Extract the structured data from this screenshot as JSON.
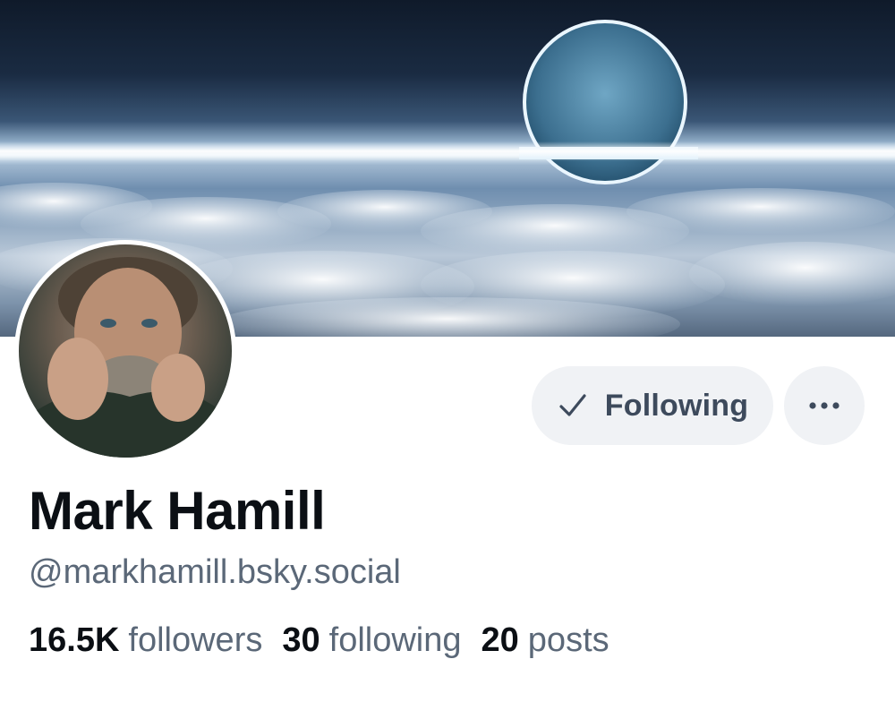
{
  "profile": {
    "display_name": "Mark Hamill",
    "handle": "@markhamill.bsky.social"
  },
  "actions": {
    "follow_label": "Following",
    "follow_icon": "check-icon",
    "more_icon": "ellipsis-icon"
  },
  "stats": {
    "followers": {
      "count": "16.5K",
      "label": "followers"
    },
    "following": {
      "count": "30",
      "label": "following"
    },
    "posts": {
      "count": "20",
      "label": "posts"
    }
  },
  "colors": {
    "button_bg": "#f0f2f5",
    "button_text": "#3d4a5c",
    "primary_text": "#0b0f14",
    "secondary_text": "#5b6878"
  }
}
